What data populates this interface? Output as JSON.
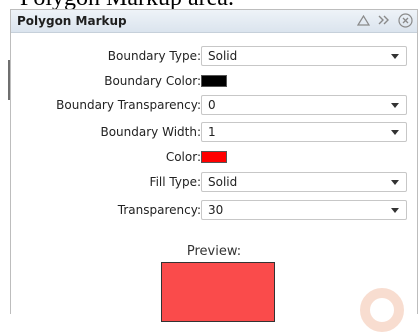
{
  "caption": "Polygon Markup area.",
  "panel": {
    "title": "Polygon Markup",
    "icons": [
      "collapse-up-icon",
      "expand-double-chevron-icon",
      "close-circle-icon"
    ]
  },
  "fields": {
    "boundary_type": {
      "label": "Boundary Type:",
      "value": "Solid"
    },
    "boundary_color": {
      "label": "Boundary Color:",
      "color": "#000000"
    },
    "boundary_transparency": {
      "label": "Boundary Transparency:",
      "value": "0"
    },
    "boundary_width": {
      "label": "Boundary Width:",
      "value": "1"
    },
    "color": {
      "label": "Color:",
      "color": "#ff0000"
    },
    "fill_type": {
      "label": "Fill Type:",
      "value": "Solid"
    },
    "transparency": {
      "label": "Transparency:",
      "value": "30"
    }
  },
  "preview": {
    "label": "Preview:",
    "fill": "#fa4b4b"
  },
  "colors": {
    "titlebar": "#dbe4ee",
    "watermark": "#f0b496"
  }
}
